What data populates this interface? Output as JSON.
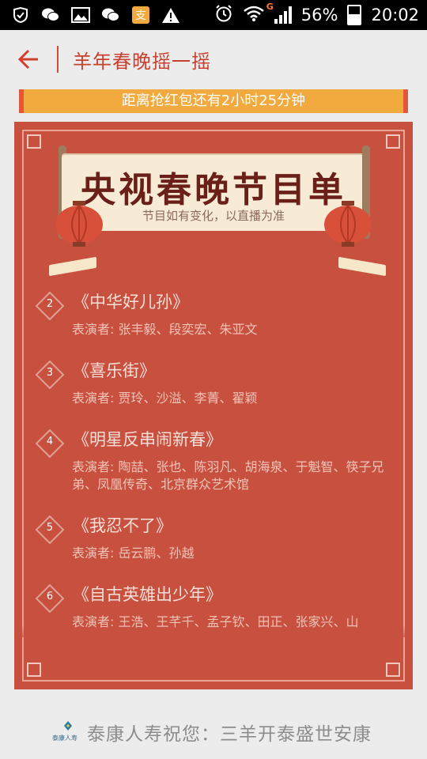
{
  "status_bar": {
    "battery": "56%",
    "time": "20:02",
    "network_type": "G",
    "icons": [
      "notification-shield-icon",
      "wechat-icon",
      "gallery-icon",
      "wechat-icon",
      "alipay-icon",
      "warning-icon",
      "alarm-icon",
      "wifi-icon",
      "signal-icon",
      "battery-icon"
    ]
  },
  "header": {
    "title": "羊年春晚摇一摇",
    "back_icon": "arrow-left-icon"
  },
  "countdown": {
    "text": "距离抢红包还有2小时25分钟"
  },
  "banner": {
    "title": "央视春晚节目单",
    "subtitle": "节目如有变化，以直播为准"
  },
  "programs": [
    {
      "num": "2",
      "title": "《中华好儿孙》",
      "performers": "表演者: 张丰毅、段奕宏、朱亚文"
    },
    {
      "num": "3",
      "title": "《喜乐街》",
      "performers": "表演者: 贾玲、沙溢、李菁、翟颖"
    },
    {
      "num": "4",
      "title": "《明星反串闹新春》",
      "performers": "表演者: 陶喆、张也、陈羽凡、胡海泉、于魁智、筷子兄弟、凤凰传奇、北京群众艺术馆"
    },
    {
      "num": "5",
      "title": "《我忍不了》",
      "performers": "表演者: 岳云鹏、孙越"
    },
    {
      "num": "6",
      "title": "《自古英雄出少年》",
      "performers": "表演者: 王浩、王芊千、孟子钦、田正、张家兴、山"
    }
  ],
  "footer": {
    "logo_text": "泰康人寿",
    "text": "泰康人寿祝您：三羊开泰盛世安康"
  },
  "colors": {
    "accent": "#c8402f",
    "card": "#c7503f",
    "countdown_bar": "#f2a93e",
    "status_bar": "#000000"
  }
}
